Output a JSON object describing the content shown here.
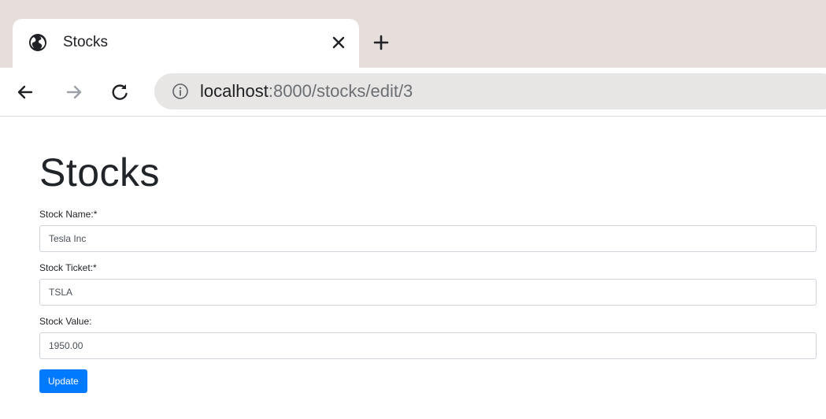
{
  "browser": {
    "tab": {
      "title": "Stocks",
      "icon": "globe-icon",
      "close_icon": "close-icon"
    },
    "new_tab_icon": "plus-icon",
    "nav": {
      "back_icon": "arrow-left-icon",
      "forward_icon": "arrow-right-icon",
      "reload_icon": "reload-icon"
    },
    "address": {
      "host": "localhost",
      "rest": ":8000/stocks/edit/3",
      "info_icon": "info-icon"
    }
  },
  "page": {
    "title": "Stocks",
    "form": {
      "name_label": "Stock Name:*",
      "name_value": "Tesla Inc",
      "ticket_label": "Stock Ticket:*",
      "ticket_value": "TSLA",
      "value_label": "Stock Value:",
      "value_value": "1950.00",
      "submit_label": "Update"
    }
  },
  "colors": {
    "tabstrip_bg": "#e5deda",
    "omnibox_bg": "#e8e6e5",
    "button_primary": "#007bff",
    "text": "#212529"
  }
}
